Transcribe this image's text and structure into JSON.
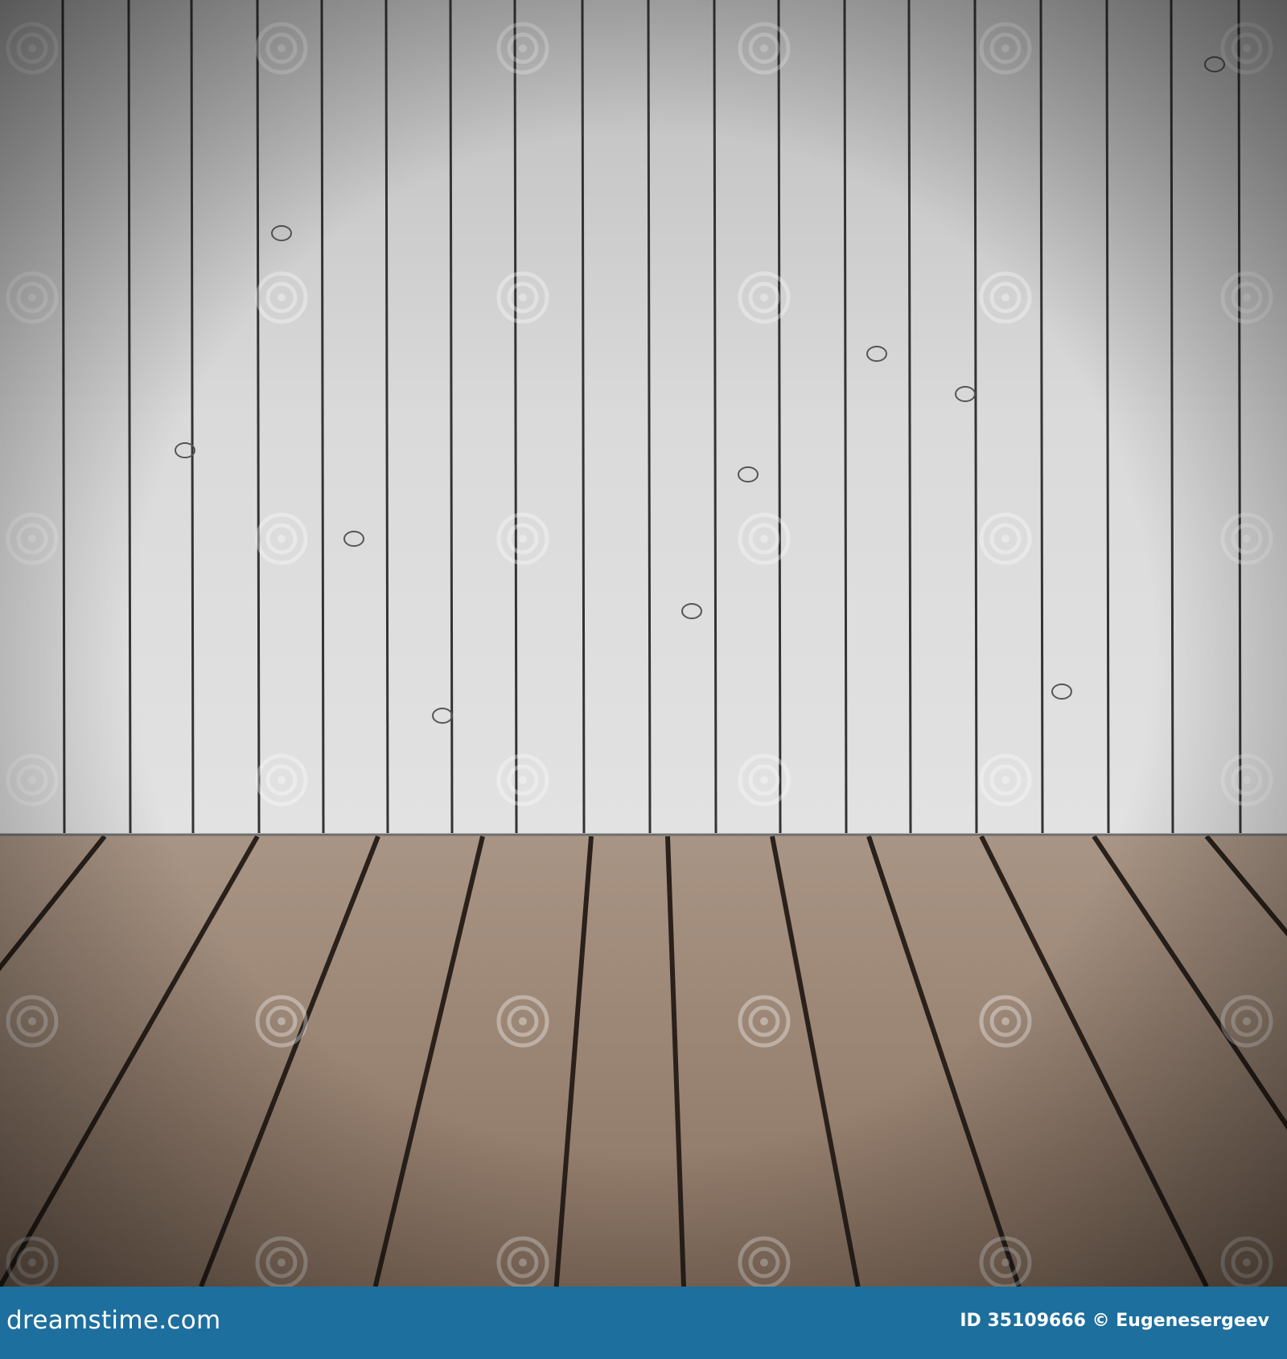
{
  "scene": {
    "description_subjects": [
      "wall-planks",
      "floor-planks"
    ],
    "colors": {
      "wall": "#d9d9d9",
      "wall_gap": "#2e2e2e",
      "floor": "#9b8574",
      "floor_gap": "#2a211b",
      "vignette": "#000000"
    },
    "watermark_text": "dreamstime"
  },
  "footer": {
    "site": "dreamstime.com",
    "id_label": "ID 35109666 © Eugenesergeev",
    "background": "#1d6f9e"
  }
}
